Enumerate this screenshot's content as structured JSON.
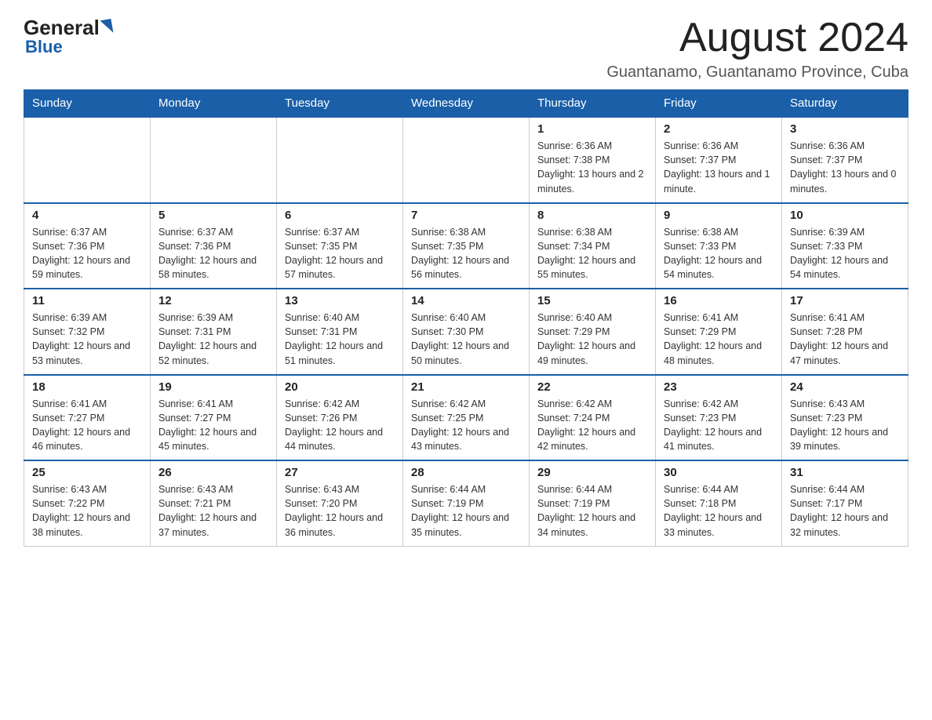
{
  "logo": {
    "general": "General",
    "blue": "Blue"
  },
  "header": {
    "month": "August 2024",
    "location": "Guantanamo, Guantanamo Province, Cuba"
  },
  "days_of_week": [
    "Sunday",
    "Monday",
    "Tuesday",
    "Wednesday",
    "Thursday",
    "Friday",
    "Saturday"
  ],
  "weeks": [
    [
      {
        "day": "",
        "info": ""
      },
      {
        "day": "",
        "info": ""
      },
      {
        "day": "",
        "info": ""
      },
      {
        "day": "",
        "info": ""
      },
      {
        "day": "1",
        "info": "Sunrise: 6:36 AM\nSunset: 7:38 PM\nDaylight: 13 hours and 2 minutes."
      },
      {
        "day": "2",
        "info": "Sunrise: 6:36 AM\nSunset: 7:37 PM\nDaylight: 13 hours and 1 minute."
      },
      {
        "day": "3",
        "info": "Sunrise: 6:36 AM\nSunset: 7:37 PM\nDaylight: 13 hours and 0 minutes."
      }
    ],
    [
      {
        "day": "4",
        "info": "Sunrise: 6:37 AM\nSunset: 7:36 PM\nDaylight: 12 hours and 59 minutes."
      },
      {
        "day": "5",
        "info": "Sunrise: 6:37 AM\nSunset: 7:36 PM\nDaylight: 12 hours and 58 minutes."
      },
      {
        "day": "6",
        "info": "Sunrise: 6:37 AM\nSunset: 7:35 PM\nDaylight: 12 hours and 57 minutes."
      },
      {
        "day": "7",
        "info": "Sunrise: 6:38 AM\nSunset: 7:35 PM\nDaylight: 12 hours and 56 minutes."
      },
      {
        "day": "8",
        "info": "Sunrise: 6:38 AM\nSunset: 7:34 PM\nDaylight: 12 hours and 55 minutes."
      },
      {
        "day": "9",
        "info": "Sunrise: 6:38 AM\nSunset: 7:33 PM\nDaylight: 12 hours and 54 minutes."
      },
      {
        "day": "10",
        "info": "Sunrise: 6:39 AM\nSunset: 7:33 PM\nDaylight: 12 hours and 54 minutes."
      }
    ],
    [
      {
        "day": "11",
        "info": "Sunrise: 6:39 AM\nSunset: 7:32 PM\nDaylight: 12 hours and 53 minutes."
      },
      {
        "day": "12",
        "info": "Sunrise: 6:39 AM\nSunset: 7:31 PM\nDaylight: 12 hours and 52 minutes."
      },
      {
        "day": "13",
        "info": "Sunrise: 6:40 AM\nSunset: 7:31 PM\nDaylight: 12 hours and 51 minutes."
      },
      {
        "day": "14",
        "info": "Sunrise: 6:40 AM\nSunset: 7:30 PM\nDaylight: 12 hours and 50 minutes."
      },
      {
        "day": "15",
        "info": "Sunrise: 6:40 AM\nSunset: 7:29 PM\nDaylight: 12 hours and 49 minutes."
      },
      {
        "day": "16",
        "info": "Sunrise: 6:41 AM\nSunset: 7:29 PM\nDaylight: 12 hours and 48 minutes."
      },
      {
        "day": "17",
        "info": "Sunrise: 6:41 AM\nSunset: 7:28 PM\nDaylight: 12 hours and 47 minutes."
      }
    ],
    [
      {
        "day": "18",
        "info": "Sunrise: 6:41 AM\nSunset: 7:27 PM\nDaylight: 12 hours and 46 minutes."
      },
      {
        "day": "19",
        "info": "Sunrise: 6:41 AM\nSunset: 7:27 PM\nDaylight: 12 hours and 45 minutes."
      },
      {
        "day": "20",
        "info": "Sunrise: 6:42 AM\nSunset: 7:26 PM\nDaylight: 12 hours and 44 minutes."
      },
      {
        "day": "21",
        "info": "Sunrise: 6:42 AM\nSunset: 7:25 PM\nDaylight: 12 hours and 43 minutes."
      },
      {
        "day": "22",
        "info": "Sunrise: 6:42 AM\nSunset: 7:24 PM\nDaylight: 12 hours and 42 minutes."
      },
      {
        "day": "23",
        "info": "Sunrise: 6:42 AM\nSunset: 7:23 PM\nDaylight: 12 hours and 41 minutes."
      },
      {
        "day": "24",
        "info": "Sunrise: 6:43 AM\nSunset: 7:23 PM\nDaylight: 12 hours and 39 minutes."
      }
    ],
    [
      {
        "day": "25",
        "info": "Sunrise: 6:43 AM\nSunset: 7:22 PM\nDaylight: 12 hours and 38 minutes."
      },
      {
        "day": "26",
        "info": "Sunrise: 6:43 AM\nSunset: 7:21 PM\nDaylight: 12 hours and 37 minutes."
      },
      {
        "day": "27",
        "info": "Sunrise: 6:43 AM\nSunset: 7:20 PM\nDaylight: 12 hours and 36 minutes."
      },
      {
        "day": "28",
        "info": "Sunrise: 6:44 AM\nSunset: 7:19 PM\nDaylight: 12 hours and 35 minutes."
      },
      {
        "day": "29",
        "info": "Sunrise: 6:44 AM\nSunset: 7:19 PM\nDaylight: 12 hours and 34 minutes."
      },
      {
        "day": "30",
        "info": "Sunrise: 6:44 AM\nSunset: 7:18 PM\nDaylight: 12 hours and 33 minutes."
      },
      {
        "day": "31",
        "info": "Sunrise: 6:44 AM\nSunset: 7:17 PM\nDaylight: 12 hours and 32 minutes."
      }
    ]
  ]
}
